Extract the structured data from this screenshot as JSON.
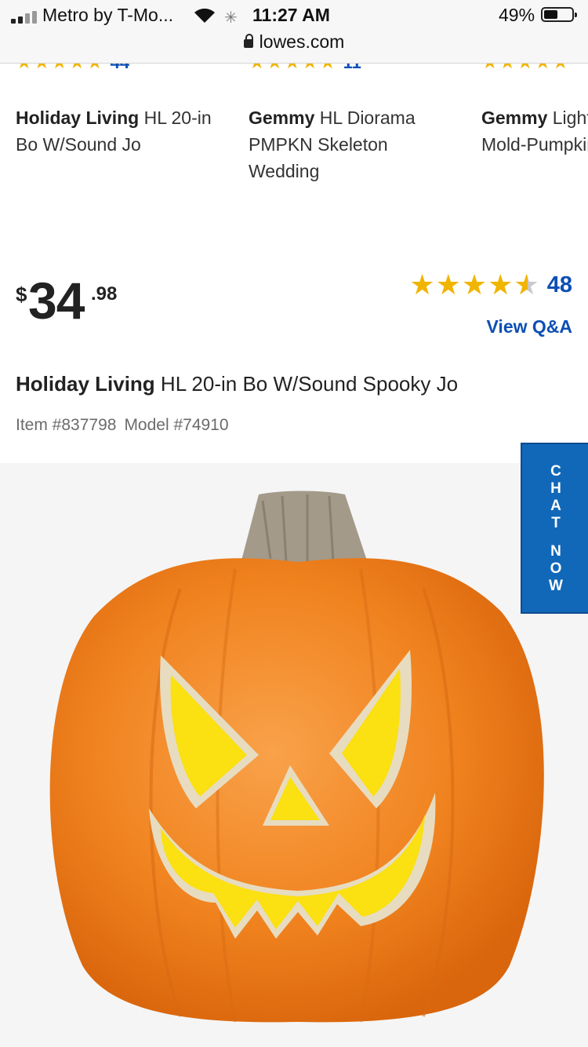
{
  "status_bar": {
    "carrier": "Metro by T-Mo...",
    "time": "11:27 AM",
    "battery": "49%",
    "url": "lowes.com"
  },
  "carousel": {
    "cards": [
      {
        "rating_count": "44",
        "brand": "Holiday Living",
        "title": "HL 20-in Bo W/Sound Jo"
      },
      {
        "rating_count": "11",
        "brand": "Gemmy",
        "title": "HL Diorama PMPKN Skeleton Wedding"
      },
      {
        "rating_count": "",
        "brand": "Gemmy",
        "title": "Lighted Blow Mold-Pumpkin-H"
      }
    ]
  },
  "product": {
    "currency": "$",
    "price_dollars": "34",
    "price_cents": ".98",
    "rating": 4.5,
    "rating_count": "48",
    "qa_link": "View Q&A",
    "brand": "Holiday Living",
    "title": "HL 20-in Bo W/Sound Spooky Jo",
    "item_number": "Item #837798",
    "model_number": "Model #74910"
  },
  "chat": {
    "word1": [
      "C",
      "H",
      "A",
      "T"
    ],
    "word2": [
      "N",
      "O",
      "W"
    ]
  },
  "colors": {
    "star": "#f0b500",
    "link_blue": "#0d4fb3",
    "chat_bg": "#1168b8",
    "pumpkin": "#f0821e"
  },
  "icons": [
    "signal-icon",
    "wifi-icon",
    "loading-spinner-icon",
    "battery-icon",
    "lock-icon",
    "star-icon"
  ]
}
